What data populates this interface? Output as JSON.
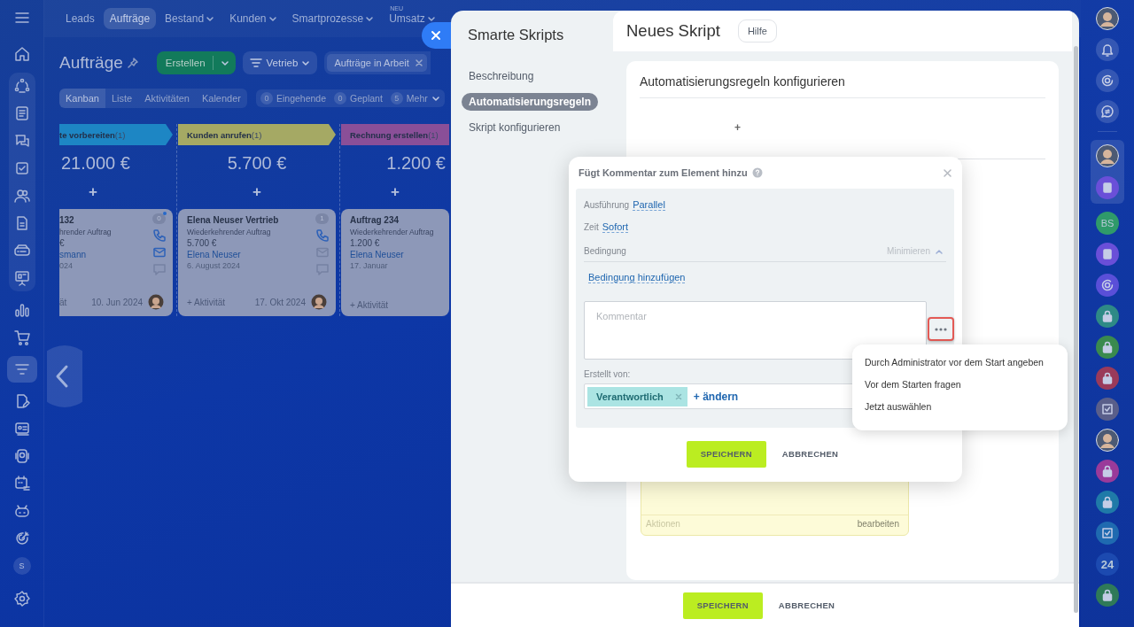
{
  "top_nav": [
    {
      "label": "Leads",
      "selected": false,
      "dropdown": false
    },
    {
      "label": "Aufträge",
      "selected": true,
      "dropdown": false
    },
    {
      "label": "Bestand",
      "selected": false,
      "dropdown": true
    },
    {
      "label": "Kunden",
      "selected": false,
      "dropdown": true
    },
    {
      "label": "Smartprozesse",
      "selected": false,
      "dropdown": true
    },
    {
      "label": "Umsatz",
      "selected": false,
      "dropdown": true,
      "badge": "NEU"
    }
  ],
  "page": {
    "title": "Aufträge",
    "create_button": "Erstellen",
    "pipeline": "Vetrieb",
    "filter_tag": "Aufträge in Arbeit"
  },
  "views": [
    {
      "label": "Kanban",
      "selected": true
    },
    {
      "label": "Liste",
      "selected": false
    },
    {
      "label": "Aktivitäten",
      "selected": false
    },
    {
      "label": "Kalender",
      "selected": false
    }
  ],
  "counters": [
    {
      "count": "0",
      "label": "Eingehende",
      "dropdown": false
    },
    {
      "count": "0",
      "label": "Geplant",
      "dropdown": false
    },
    {
      "count": "5",
      "label": "Mehr",
      "dropdown": true
    }
  ],
  "kanban": {
    "columns": [
      {
        "title": "te vorbereiten",
        "count": "(1)",
        "color": "#1d86c4",
        "amount": "21.000 €",
        "add_button": "+",
        "cut": true,
        "card": {
          "title": "132",
          "subtitle": "hrender Auftrag",
          "amount": "€",
          "contact": "smann",
          "date": "024",
          "activity": "ät",
          "deadline": "10. Jun 2024",
          "counter": "0",
          "counter_dot": true,
          "contact_icons": true,
          "email_active": true,
          "avatar": true
        }
      },
      {
        "title": "Kunden anrufen",
        "count": "(1)",
        "color": "#a5a964",
        "amount": "5.700 €",
        "add_button": "+",
        "cut": false,
        "card": {
          "title": "Elena Neuser Vertrieb",
          "subtitle": "Wiederkehrender Auftrag",
          "amount": "5.700 €",
          "contact": "Elena Neuser",
          "date": "6. August 2024",
          "activity": "+ Aktivität",
          "deadline": "17. Okt 2024",
          "counter": "1",
          "counter_dot": false,
          "contact_icons": true,
          "email_active": false,
          "avatar": true
        }
      },
      {
        "title": "Rechnung erstellen",
        "count": "(1)",
        "color": "#8a4f98",
        "amount": "1.200 €",
        "add_button": "+",
        "cut": false,
        "card": {
          "title": "Auftrag 234",
          "subtitle": "Wiederkehrender Auftrag",
          "amount": "1.200 €",
          "contact": "Elena Neuser",
          "date": "17. Januar",
          "activity": "+ Aktivität",
          "contact_icons": false,
          "avatar": false
        }
      }
    ]
  },
  "left_nav": [
    {
      "selected": false
    },
    {
      "selected": false
    },
    {
      "selected": false
    },
    {
      "selected": false
    },
    {
      "selected": false
    },
    {
      "selected": false
    },
    {
      "selected": false
    },
    {
      "selected": false
    },
    {
      "selected": false
    },
    {
      "selected": false
    },
    {
      "selected": false
    },
    {
      "selected": true
    },
    {
      "selected": false
    },
    {
      "selected": false
    },
    {
      "selected": false
    },
    {
      "selected": false
    },
    {
      "selected": false
    },
    {
      "selected": false
    },
    {
      "label": "S",
      "selected": false
    }
  ],
  "right_bar": [
    {
      "kind": "avatar"
    },
    {
      "kind": "bell"
    },
    {
      "kind": "ring"
    },
    {
      "kind": "chat"
    },
    {
      "kind": "avatar",
      "grouped": true
    },
    {
      "kind": "contact",
      "color": "#6a4fd8",
      "grouped": true
    },
    {
      "kind": "text",
      "label": "BS",
      "color": "#2f9a6a"
    },
    {
      "kind": "contact",
      "color": "#6a4fd8"
    },
    {
      "kind": "ring",
      "color": "#5a4fd8"
    },
    {
      "kind": "lock",
      "color": "#2e8a86"
    },
    {
      "kind": "lock",
      "color": "#3a8a4e"
    },
    {
      "kind": "lock",
      "color": "#9a3a5a"
    },
    {
      "kind": "task",
      "color": "#5a5f8a"
    },
    {
      "kind": "avatar"
    },
    {
      "kind": "lock",
      "color": "#9a3a9a"
    },
    {
      "kind": "lock",
      "color": "#1f7aa8"
    },
    {
      "kind": "task",
      "color": "#1f6ab0"
    },
    {
      "kind": "text",
      "label": "24",
      "color": "#1c4ab0"
    },
    {
      "kind": "lock",
      "color": "#2f7a58"
    }
  ],
  "slider": {
    "title": "Smarte Skripts",
    "nav": [
      {
        "label": "Beschreibung",
        "selected": false
      },
      {
        "label": "Automatisierungsregeln",
        "selected": true
      },
      {
        "label": "Skript konfigurieren",
        "selected": false
      }
    ],
    "heading": "Neues Skript",
    "help_button": "Hilfe",
    "section_title": "Automatisierungsregeln konfigurieren",
    "add": "+",
    "rule_card": {
      "actions": "Aktionen",
      "edit": "bearbeiten"
    },
    "save_button": "SPEICHERN",
    "cancel_button": "ABBRECHEN"
  },
  "dialog": {
    "title": "Fügt Kommentar zum Element hinzu",
    "execution": {
      "label": "Ausführung",
      "value": "Parallel"
    },
    "time": {
      "label": "Zeit",
      "value": "Sofort"
    },
    "condition": {
      "label": "Bedingung",
      "toggle": "Minimieren",
      "expanded": true,
      "add_link": "Bedingung hinzufügen"
    },
    "comment": {
      "placeholder": "Kommentar",
      "more_highlighted": true
    },
    "created_by": {
      "label": "Erstellt von:",
      "tag": "Verantwortlich",
      "change": "+ ändern"
    },
    "save_button": "SPEICHERN",
    "cancel_button": "ABBRECHEN"
  },
  "menu": [
    {
      "label": "Durch Administrator vor dem Start angeben"
    },
    {
      "label": "Vor dem Starten fragen"
    },
    {
      "label": "Jetzt auswählen"
    }
  ]
}
